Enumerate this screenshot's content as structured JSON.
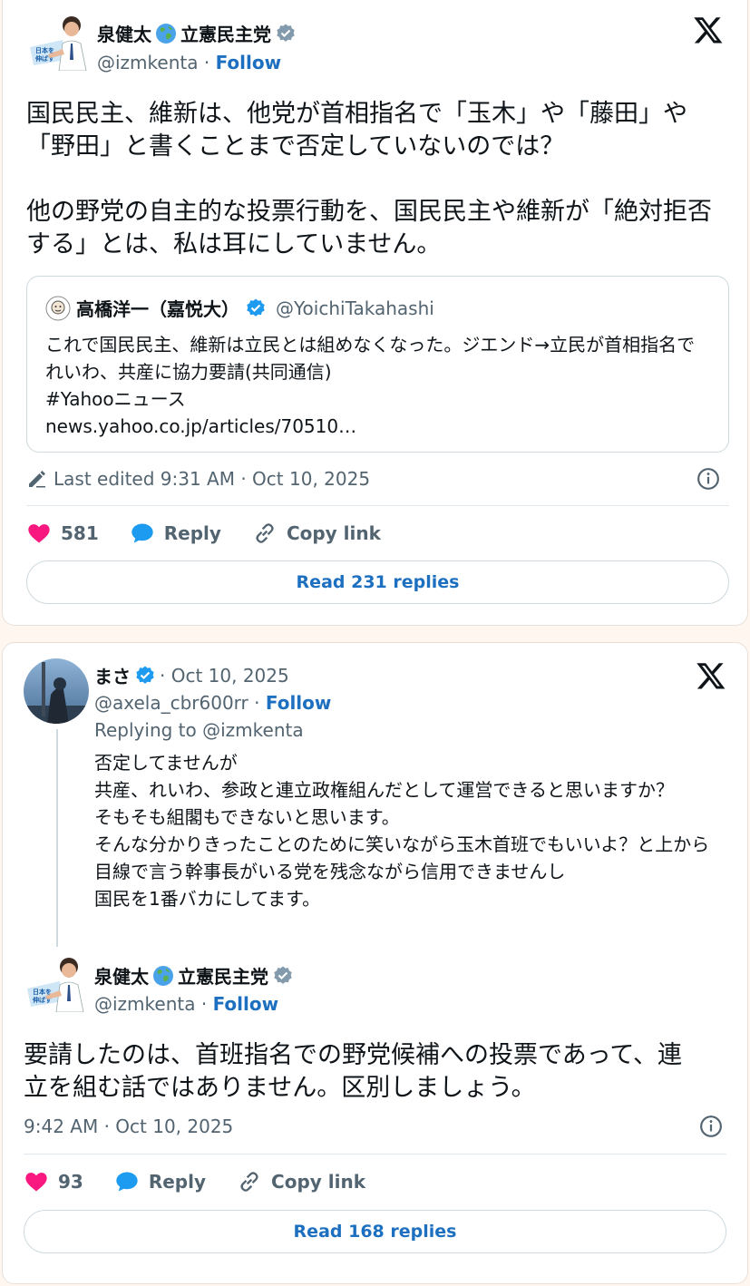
{
  "tweet1": {
    "author_name": "泉健太",
    "author_name_suffix": "立憲民主党",
    "handle": "@izmkenta",
    "separator": "·",
    "follow": "Follow",
    "text": "国民民主、維新は、他党が首相指名で「玉木」や「藤田」や「野田」と書くことまで否定していないのでは？\n\n他の野党の自主的な投票行動を、国民民主や維新が「絶対拒否する」とは、私は耳にしていません。",
    "quote": {
      "name": "高橋洋一（嘉悦大）",
      "handle": "@YoichiTakahashi",
      "text": "これで国民民主、維新は立民とは組めなくなった。ジエンド→立民が首相指名でれいわ、共産に協力要請(共同通信)\n#Yahooニュース\nnews.yahoo.co.jp/articles/70510…"
    },
    "timestamp": "Last edited 9:31 AM · Oct 10, 2025",
    "likes": "581",
    "reply_label": "Reply",
    "copy_label": "Copy link",
    "read_replies": "Read 231 replies"
  },
  "tweet2": {
    "author_name": "まさ",
    "date": "· Oct 10, 2025",
    "handle": "@axela_cbr600rr",
    "separator": "·",
    "follow": "Follow",
    "replying_to": "Replying to @izmkenta",
    "text": "否定してませんが\n共産、れいわ、参政と連立政権組んだとして運営できると思いますか？\nそもそも組閣もできないと思います。\nそんな分かりきったことのために笑いながら玉木首班でもいいよ？と上から目線で言う幹事長がいる党を残念ながら信用できませんし\n国民を1番バカにしてます。"
  },
  "tweet3": {
    "author_name": "泉健太",
    "author_name_suffix": "立憲民主党",
    "handle": "@izmkenta",
    "separator": "·",
    "follow": "Follow",
    "text": "要請したのは、首班指名での野党候補への投票であって、連立を組む話ではありません。区別しましょう。",
    "timestamp": "9:42 AM · Oct 10, 2025",
    "likes": "93",
    "reply_label": "Reply",
    "copy_label": "Copy link",
    "read_replies": "Read 168 replies"
  },
  "icons": {
    "x_logo": "x-logo-icon",
    "globe": "globe-icon",
    "verified": "verified-badge-icon",
    "heart": "heart-icon",
    "reply": "reply-bubble-icon",
    "link": "link-icon",
    "info": "info-icon",
    "pencil": "pencil-icon"
  },
  "colors": {
    "link_blue": "#1d6fc0",
    "heart": "#f91880",
    "reply_blue": "#1d9bf0",
    "verified_blue": "#1d9bf0",
    "muted": "#536471",
    "background": "#fff7ef"
  }
}
